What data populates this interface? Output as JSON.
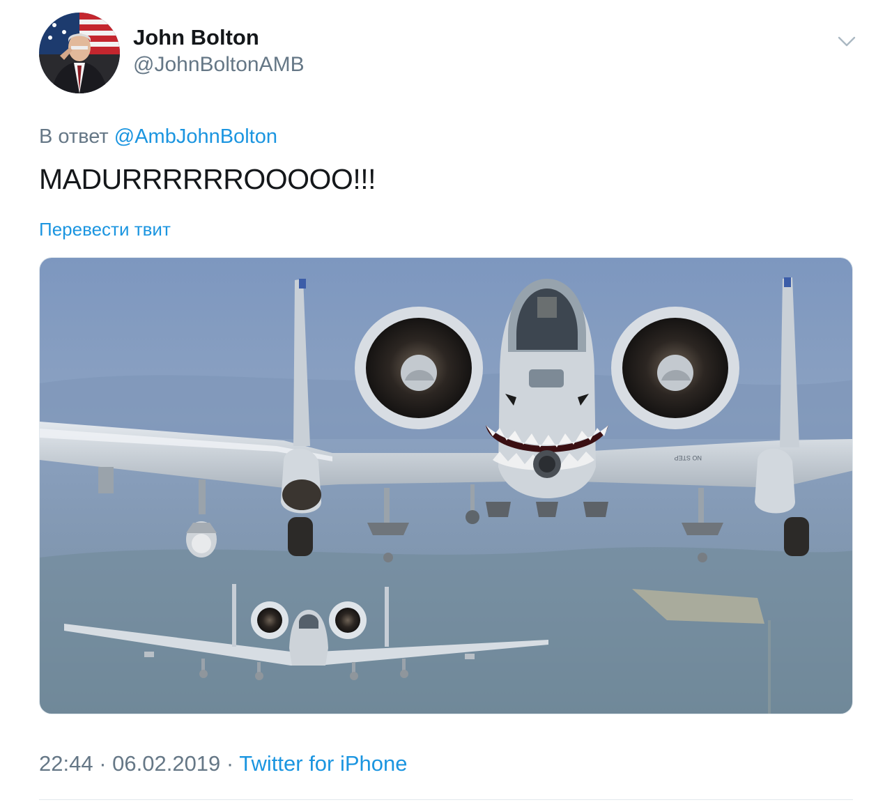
{
  "tweet": {
    "author": {
      "name": "John Bolton",
      "handle": "@JohnBoltonAMB",
      "avatar_icon": "avatar-photo"
    },
    "menu_icon": "chevron-down-icon",
    "reply": {
      "prefix": "В ответ",
      "mention": "@AmbJohnBolton"
    },
    "text": "MADURRRRRROOOOO!!!",
    "translate_label": "Перевести твит",
    "media": {
      "kind": "photo",
      "painted_text": "NO STEP"
    },
    "meta": {
      "time": "22:44",
      "separator": " · ",
      "date": "06.02.2019",
      "source": "Twitter for iPhone"
    },
    "colors": {
      "link": "#1b95e0",
      "secondary_text": "#657786",
      "primary_text": "#14171a",
      "divider": "#e1e8ed"
    }
  }
}
